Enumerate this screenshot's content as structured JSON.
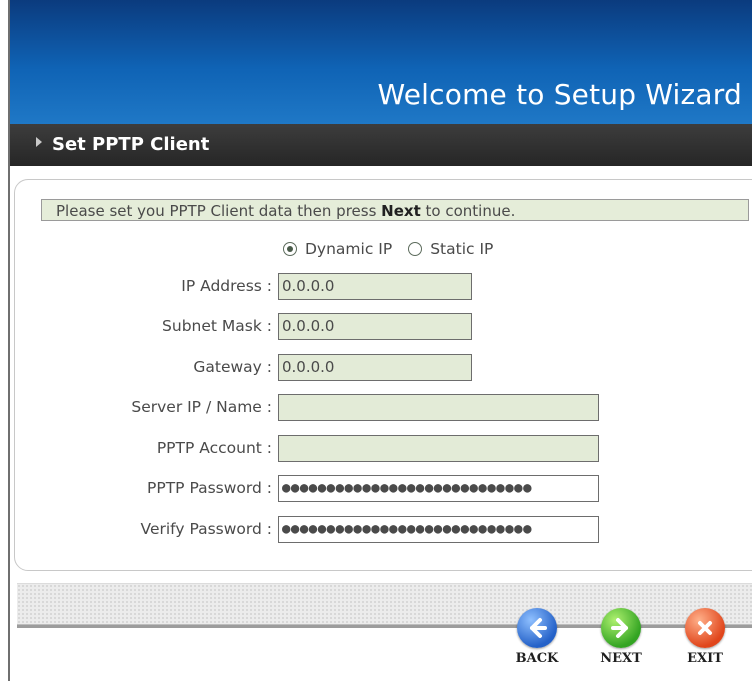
{
  "header": {
    "title": "Welcome to Setup Wizard"
  },
  "section": {
    "title": "Set PPTP Client"
  },
  "notice": {
    "prefix": "Please set you PPTP Client data then press ",
    "bold": "Next",
    "suffix": " to continue."
  },
  "ip_mode": {
    "options": [
      {
        "label": "Dynamic IP",
        "selected": true
      },
      {
        "label": "Static IP",
        "selected": false
      }
    ]
  },
  "fields": [
    {
      "label": "IP Address :",
      "value": "0.0.0.0"
    },
    {
      "label": "Subnet Mask :",
      "value": "0.0.0.0"
    },
    {
      "label": "Gateway :",
      "value": "0.0.0.0"
    },
    {
      "label": "Server IP / Name :",
      "value": ""
    },
    {
      "label": "PPTP Account :",
      "value": ""
    },
    {
      "label": "PPTP Password :",
      "value": "●●●●●●●●●●●●●●●●●●●●●●●●●●●●"
    },
    {
      "label": "Verify Password :",
      "value": "●●●●●●●●●●●●●●●●●●●●●●●●●●●●"
    }
  ],
  "nav": {
    "back_label": "BACK",
    "next_label": "NEXT",
    "exit_label": "EXIT"
  },
  "colors": {
    "header_blue": "#0f63b5",
    "section_bar": "#2b2b2b",
    "field_green": "#e3ebd7"
  },
  "icons": {
    "back": "arrow-left-icon",
    "next": "arrow-right-icon",
    "exit": "close-x-icon"
  }
}
